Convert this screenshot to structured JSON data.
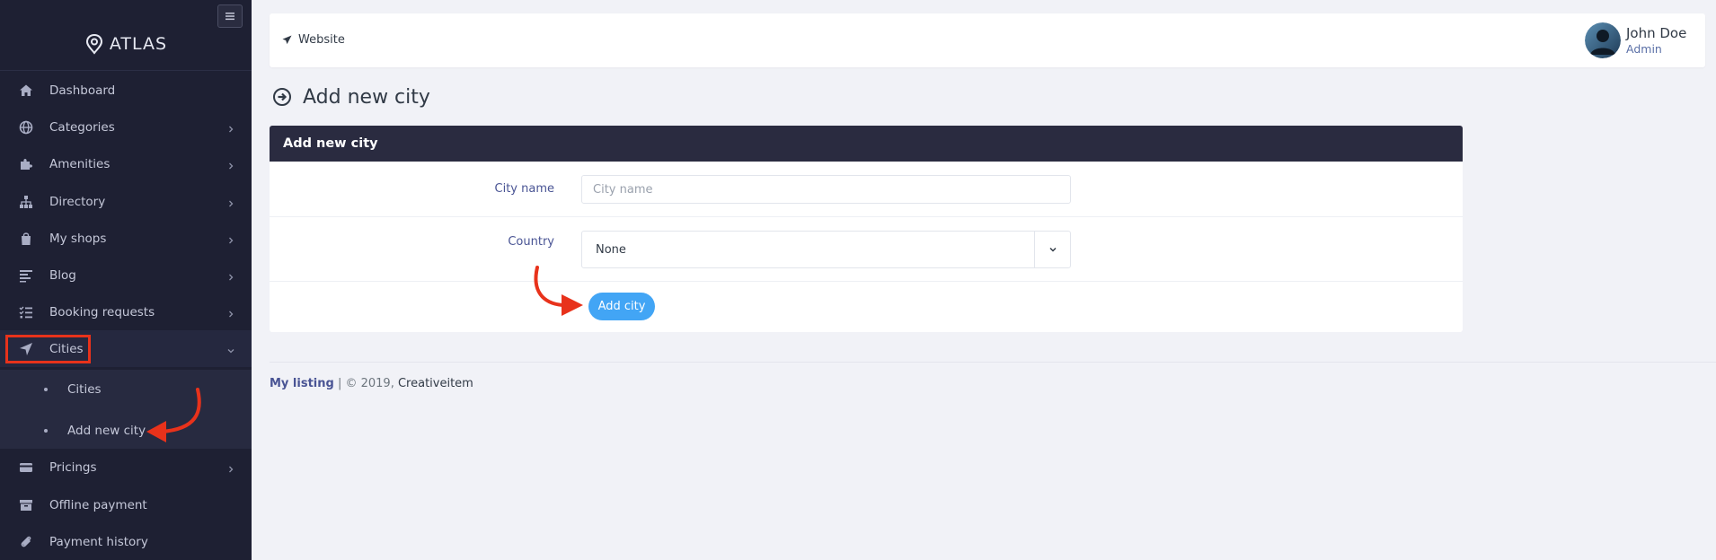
{
  "app": {
    "logo_text": "ATLAS"
  },
  "sidebar": {
    "items": [
      {
        "label": "Dashboard",
        "icon": "home-icon",
        "has_children": false
      },
      {
        "label": "Categories",
        "icon": "globe-icon",
        "has_children": true
      },
      {
        "label": "Amenities",
        "icon": "puzzle-icon",
        "has_children": true
      },
      {
        "label": "Directory",
        "icon": "sitemap-icon",
        "has_children": true
      },
      {
        "label": "My shops",
        "icon": "shopping-bag-icon",
        "has_children": true
      },
      {
        "label": "Blog",
        "icon": "align-left-icon",
        "has_children": true
      },
      {
        "label": "Booking requests",
        "icon": "tasks-icon",
        "has_children": true
      },
      {
        "label": "Cities",
        "icon": "location-arrow-icon",
        "has_children": true,
        "expanded": true
      },
      {
        "label": "Pricings",
        "icon": "credit-card-icon",
        "has_children": true
      },
      {
        "label": "Offline payment",
        "icon": "archive-icon",
        "has_children": false
      },
      {
        "label": "Payment history",
        "icon": "paperclip-icon",
        "has_children": false
      }
    ],
    "cities_submenu": [
      {
        "label": "Cities"
      },
      {
        "label": "Add new city"
      }
    ]
  },
  "topbar": {
    "website_label": "Website",
    "user": {
      "name": "John Doe",
      "role": "Admin"
    }
  },
  "page": {
    "title": "Add new city"
  },
  "form": {
    "header": "Add new city",
    "city_name_label": "City name",
    "city_name_value": "",
    "city_name_placeholder": "City name",
    "country_label": "Country",
    "country_value": "None",
    "submit_label": "Add city"
  },
  "footer": {
    "brand": "My listing",
    "copyright": " | © 2019, ",
    "company": "Creativeitem"
  },
  "colors": {
    "sidebar_bg": "#1e2033",
    "card_header_bg": "#2a2b40",
    "primary_button": "#42a5f5",
    "annotation_red": "#e8321b"
  }
}
